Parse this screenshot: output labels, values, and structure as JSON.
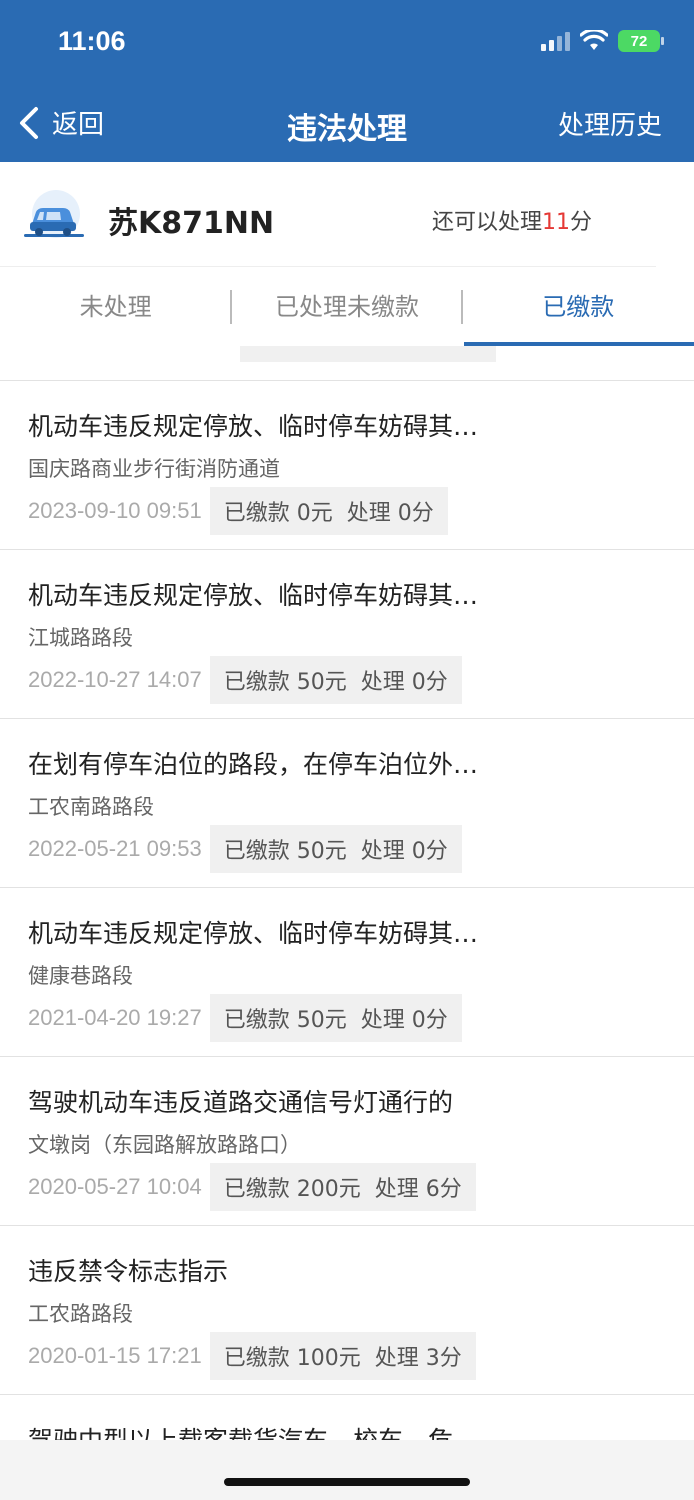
{
  "status": {
    "time": "11:06",
    "battery": "72"
  },
  "nav": {
    "back_label": "返回",
    "title": "违法处理",
    "history_label": "处理历史"
  },
  "vehicle": {
    "plate": "苏K871NN",
    "remain_prefix": "还可以处理",
    "remain_points": "11",
    "remain_suffix": "分"
  },
  "tabs": [
    {
      "label": "未处理",
      "active": false
    },
    {
      "label": "已处理未缴款",
      "active": false
    },
    {
      "label": "已缴款",
      "active": true
    }
  ],
  "records": [
    {
      "reason": "机动车违反规定停放、临时停车妨碍其…",
      "place": "国庆路商业步行街消防通道",
      "time": "2023-09-10 09:51",
      "paid": "已缴款 0元",
      "points": "处理 0分"
    },
    {
      "reason": "机动车违反规定停放、临时停车妨碍其…",
      "place": "江城路路段",
      "time": "2022-10-27 14:07",
      "paid": "已缴款 50元",
      "points": "处理 0分"
    },
    {
      "reason": "在划有停车泊位的路段，在停车泊位外…",
      "place": "工农南路路段",
      "time": "2022-05-21 09:53",
      "paid": "已缴款 50元",
      "points": "处理 0分"
    },
    {
      "reason": "机动车违反规定停放、临时停车妨碍其…",
      "place": "健康巷路段",
      "time": "2021-04-20 19:27",
      "paid": "已缴款 50元",
      "points": "处理 0分"
    },
    {
      "reason": "驾驶机动车违反道路交通信号灯通行的",
      "place": "文墩岗（东园路解放路路口）",
      "time": "2020-05-27 10:04",
      "paid": "已缴款 200元",
      "points": "处理 6分"
    },
    {
      "reason": "违反禁令标志指示",
      "place": "工农路路段",
      "time": "2020-01-15 17:21",
      "paid": "已缴款 100元",
      "points": "处理 3分"
    },
    {
      "reason": "驾驶中型以上载客载货汽车、校车、危",
      "place": "",
      "time": "",
      "paid": "",
      "points": ""
    }
  ]
}
